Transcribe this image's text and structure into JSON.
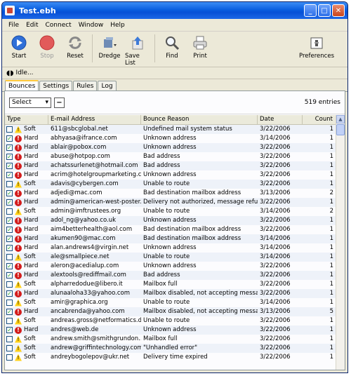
{
  "window": {
    "title": "Test.ebh"
  },
  "menu": [
    "File",
    "Edit",
    "Connect",
    "Window",
    "Help"
  ],
  "toolbar": {
    "start": "Start",
    "stop": "Stop",
    "reset": "Reset",
    "dredge": "Dredge",
    "save_list": "Save List",
    "find": "Find",
    "print": "Print",
    "preferences": "Preferences"
  },
  "status": "Idle...",
  "tabs": [
    "Bounces",
    "Settings",
    "Rules",
    "Log"
  ],
  "controls": {
    "select_label": "Select",
    "minus_label": "−",
    "entries": "519 entries"
  },
  "columns": {
    "type": "Type",
    "email": "E-mail Address",
    "reason": "Bounce Reason",
    "date": "Date",
    "count": "Count"
  },
  "colors": {
    "hard": "#d31c1c",
    "soft": "#ffd21c",
    "titlebar": "#0a5fe0"
  },
  "rows": [
    {
      "checked": false,
      "type": "Soft",
      "email": "611@sbcglobal.net",
      "reason": "Undefined mail system status",
      "date": "3/22/2006",
      "count": "1"
    },
    {
      "checked": true,
      "type": "Hard",
      "email": "abhyasa@ifrance.com",
      "reason": "Unknown address",
      "date": "3/14/2006",
      "count": "1"
    },
    {
      "checked": true,
      "type": "Hard",
      "email": "ablair@pobox.com",
      "reason": "Unknown address",
      "date": "3/22/2006",
      "count": "1"
    },
    {
      "checked": true,
      "type": "Hard",
      "email": "abuse@hotpop.com",
      "reason": "Bad address",
      "date": "3/22/2006",
      "count": "1"
    },
    {
      "checked": true,
      "type": "Hard",
      "email": "achatssurlenet@hotmail.com",
      "reason": "Bad address",
      "date": "3/22/2006",
      "count": "1"
    },
    {
      "checked": true,
      "type": "Hard",
      "email": "acrim@hotelgroupmarketing.com",
      "reason": "Unknown address",
      "date": "3/22/2006",
      "count": "1"
    },
    {
      "checked": false,
      "type": "Soft",
      "email": "adavis@cybergen.com",
      "reason": "Unable to route",
      "date": "3/22/2006",
      "count": "1"
    },
    {
      "checked": true,
      "type": "Hard",
      "email": "adjedi@mac.com",
      "reason": "Bad destination mailbox address",
      "date": "3/13/2006",
      "count": "2"
    },
    {
      "checked": true,
      "type": "Hard",
      "email": "admin@american-west-poster...",
      "reason": "Delivery not authorized, message refused",
      "date": "3/22/2006",
      "count": "1"
    },
    {
      "checked": false,
      "type": "Soft",
      "email": "admin@imftrustees.org",
      "reason": "Unable to route",
      "date": "3/14/2006",
      "count": "2"
    },
    {
      "checked": true,
      "type": "Hard",
      "email": "adol_ng@yahoo.co.uk",
      "reason": "Unknown address",
      "date": "3/22/2006",
      "count": "1"
    },
    {
      "checked": true,
      "type": "Hard",
      "email": "aim4betterhealth@aol.com",
      "reason": "Bad destination mailbox address",
      "date": "3/22/2006",
      "count": "1"
    },
    {
      "checked": true,
      "type": "Hard",
      "email": "akumen90@mac.com",
      "reason": "Bad destination mailbox address",
      "date": "3/14/2006",
      "count": "1"
    },
    {
      "checked": true,
      "type": "Hard",
      "email": "alan.andrews4@virgin.net",
      "reason": "Unknown address",
      "date": "3/14/2006",
      "count": "1"
    },
    {
      "checked": false,
      "type": "Soft",
      "email": "ale@smallpiece.net",
      "reason": "Unable to route",
      "date": "3/14/2006",
      "count": "1"
    },
    {
      "checked": true,
      "type": "Hard",
      "email": "aleron@acedialup.com",
      "reason": "Unknown address",
      "date": "3/22/2006",
      "count": "1"
    },
    {
      "checked": true,
      "type": "Hard",
      "email": "alextools@rediffmail.com",
      "reason": "Bad address",
      "date": "3/22/2006",
      "count": "1"
    },
    {
      "checked": false,
      "type": "Soft",
      "email": "alpharredodue@libero.it",
      "reason": "Mailbox full",
      "date": "3/22/2006",
      "count": "1"
    },
    {
      "checked": true,
      "type": "Hard",
      "email": "alunaaloha33@yahoo.com",
      "reason": "Mailbox disabled, not accepting messages",
      "date": "3/22/2006",
      "count": "1"
    },
    {
      "checked": false,
      "type": "Soft",
      "email": "amir@graphica.org",
      "reason": "Unable to route",
      "date": "3/14/2006",
      "count": "1"
    },
    {
      "checked": true,
      "type": "Hard",
      "email": "ancabrenda@yahoo.com",
      "reason": "Mailbox disabled, not accepting messages",
      "date": "3/13/2006",
      "count": "5"
    },
    {
      "checked": false,
      "type": "Soft",
      "email": "andreas.gross@netformatics.de",
      "reason": "Unable to route",
      "date": "3/22/2006",
      "count": "1"
    },
    {
      "checked": true,
      "type": "Hard",
      "email": "andres@web.de",
      "reason": "Unknown address",
      "date": "3/22/2006",
      "count": "1"
    },
    {
      "checked": false,
      "type": "Soft",
      "email": "andrew.smith@smithgrundon....",
      "reason": "Mailbox full",
      "date": "3/22/2006",
      "count": "1"
    },
    {
      "checked": false,
      "type": "Soft",
      "email": "andrew@griffintechnology.com",
      "reason": "\"Unhandled error\"",
      "date": "3/22/2006",
      "count": "1"
    },
    {
      "checked": false,
      "type": "Soft",
      "email": "andreybogolepov@ukr.net",
      "reason": "Delivery time expired",
      "date": "3/22/2006",
      "count": "1"
    }
  ]
}
